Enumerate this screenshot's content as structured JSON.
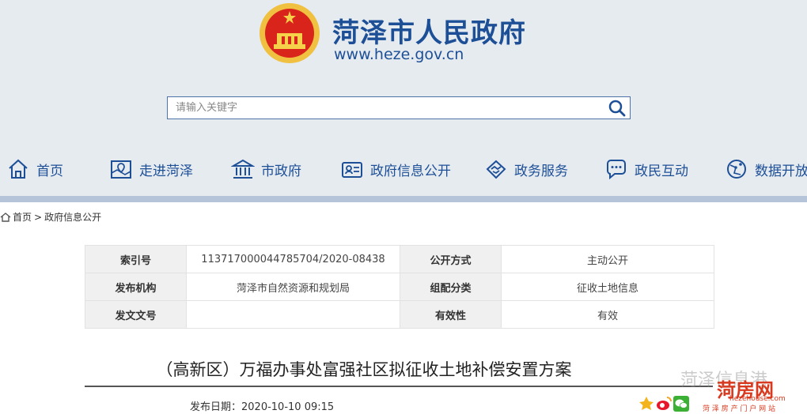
{
  "site": {
    "title": "菏泽市人民政府",
    "url": "www.heze.gov.cn"
  },
  "search": {
    "placeholder": "请输入关键字",
    "icon": "search-icon"
  },
  "nav": [
    {
      "label": "首页",
      "icon": "home-icon"
    },
    {
      "label": "走进菏泽",
      "icon": "map-icon"
    },
    {
      "label": "市政府",
      "icon": "building-icon"
    },
    {
      "label": "政府信息公开",
      "icon": "info-card-icon"
    },
    {
      "label": "政务服务",
      "icon": "handshake-icon"
    },
    {
      "label": "政民互动",
      "icon": "chat-icon"
    },
    {
      "label": "数据开放",
      "icon": "globe-icon"
    }
  ],
  "breadcrumb": {
    "home": "首页",
    "separator": ">",
    "current": "政府信息公开"
  },
  "info_table": {
    "rows": [
      {
        "label1": "索引号",
        "value1": "11371700004478570​4/2020-08438",
        "label2": "公开方式",
        "value2": "主动公开"
      },
      {
        "label1": "发布机构",
        "value1": "菏泽市自然资源和规划局",
        "label2": "组配分类",
        "value2": "征收土地信息"
      },
      {
        "label1": "发文文号",
        "value1": "",
        "label2": "有效性",
        "value2": "有效"
      }
    ]
  },
  "article": {
    "title": "（高新区）万福办事处富强社区拟征收土地补偿安置方案",
    "date_label": "发布日期：",
    "date_value": "2020-10-10 09:15"
  },
  "watermark": {
    "text": "菏泽信息港",
    "logo": "菏房网",
    "url": "hezehouse.com",
    "sub": "菏 泽 房 产 门 户 网 站"
  },
  "colors": {
    "brand_blue": "#1d4f97",
    "header_bg": "#e6ebf0"
  }
}
